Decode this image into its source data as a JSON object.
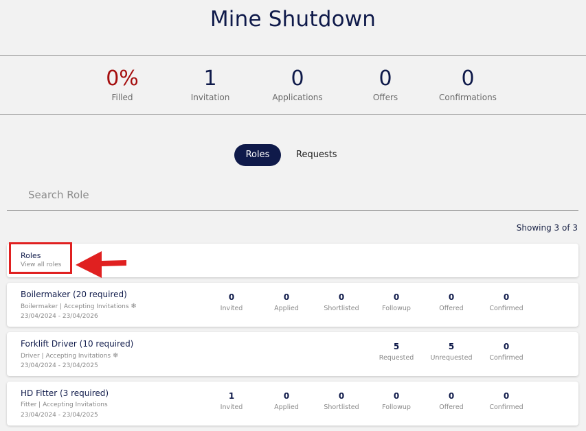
{
  "page": {
    "title": "Mine Shutdown"
  },
  "stats": [
    {
      "value": "0%",
      "label": "Filled",
      "color": "#a50e0e"
    },
    {
      "value": "1",
      "label": "Invitation"
    },
    {
      "value": "0",
      "label": "Applications"
    },
    {
      "value": "0",
      "label": "Offers"
    },
    {
      "value": "0",
      "label": "Confirmations"
    }
  ],
  "tabs": {
    "active": "Roles",
    "inactive": "Requests"
  },
  "search": {
    "placeholder": "Search Role",
    "value": ""
  },
  "showing": "Showing 3 of 3",
  "roles_header": {
    "title": "Roles",
    "subtitle": "View all roles"
  },
  "roles": [
    {
      "name": "Boilermaker (20 required)",
      "subtitle": "Boilermaker | Accepting Invitations",
      "status_icon": "snowflake-icon",
      "dates": "23/04/2024 - 23/04/2026",
      "metrics": [
        {
          "value": "0",
          "label": "Invited"
        },
        {
          "value": "0",
          "label": "Applied"
        },
        {
          "value": "0",
          "label": "Shortlisted"
        },
        {
          "value": "0",
          "label": "Followup"
        },
        {
          "value": "0",
          "label": "Offered"
        },
        {
          "value": "0",
          "label": "Confirmed"
        }
      ]
    },
    {
      "name": "Forklift Driver (10 required)",
      "subtitle": "Driver | Accepting Invitations",
      "status_icon": "snowflake-icon",
      "dates": "23/04/2024 - 23/04/2025",
      "metrics": [
        {
          "value": "5",
          "label": "Requested"
        },
        {
          "value": "5",
          "label": "Unrequested"
        },
        {
          "value": "0",
          "label": "Confirmed"
        }
      ]
    },
    {
      "name": "HD Fitter (3 required)",
      "subtitle": "Fitter | Accepting Invitations",
      "dates": "23/04/2024 - 23/04/2025",
      "metrics": [
        {
          "value": "1",
          "label": "Invited"
        },
        {
          "value": "0",
          "label": "Applied"
        },
        {
          "value": "0",
          "label": "Shortlisted"
        },
        {
          "value": "0",
          "label": "Followup"
        },
        {
          "value": "0",
          "label": "Offered"
        },
        {
          "value": "0",
          "label": "Confirmed"
        }
      ]
    }
  ],
  "colors": {
    "navy": "#0f1a4a",
    "accent_red": "#e02020",
    "filled_red": "#a50e0e"
  }
}
